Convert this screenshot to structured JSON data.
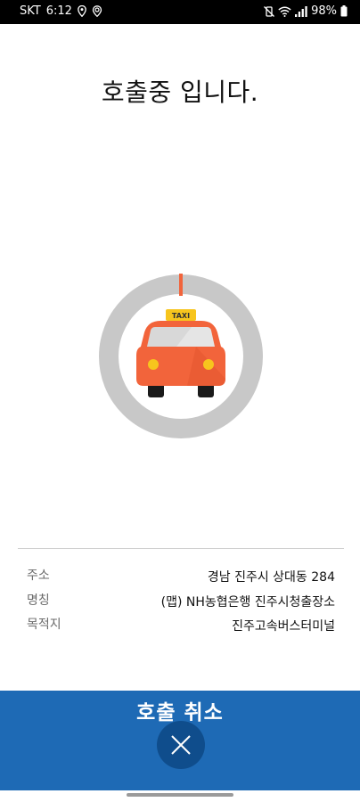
{
  "status_bar": {
    "carrier": "SKT",
    "time": "6:12",
    "battery": "98%",
    "icons_left": [
      "location-pin-icon",
      "location-target-icon"
    ],
    "icons_right": [
      "mute-vibrate-icon",
      "wifi-icon",
      "signal-icon",
      "battery-icon"
    ]
  },
  "main": {
    "title": "호출중 입니다.",
    "taxi_sign": "TAXI",
    "colors": {
      "ring": "#c8c8c8",
      "car_body": "#f2643b",
      "progress_mark": "#f2643b"
    }
  },
  "info": {
    "rows": [
      {
        "label": "주소",
        "value": "경남 진주시 상대동 284"
      },
      {
        "label": "명칭",
        "value": "(맵) NH농협은행 진주시청출장소"
      },
      {
        "label": "목적지",
        "value": "진주고속버스터미널"
      }
    ]
  },
  "cancel": {
    "label": "호출 취소",
    "bg_color": "#1e6ab5",
    "button_color": "#0f4d8c"
  }
}
